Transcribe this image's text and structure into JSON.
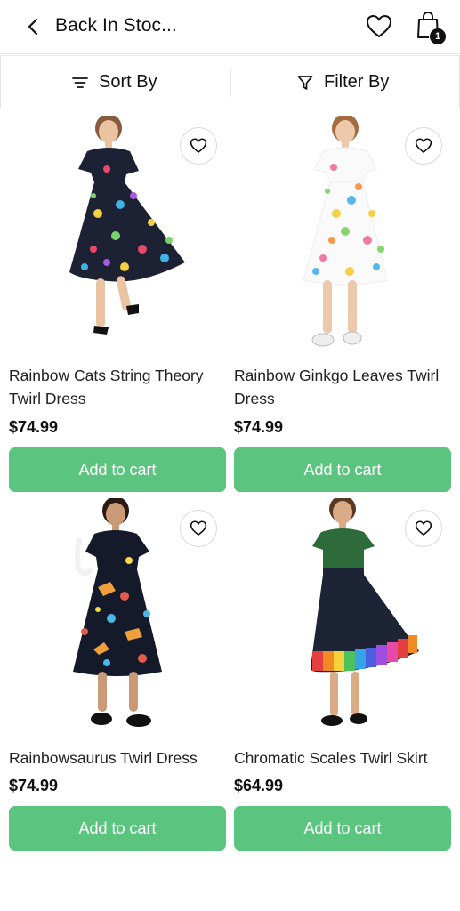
{
  "header": {
    "title": "Back In Stoc...",
    "cart_count": "1"
  },
  "toolbar": {
    "sort_label": "Sort By",
    "filter_label": "Filter By"
  },
  "products": [
    {
      "name": "Rainbow Cats String Theory Twirl Dress",
      "price": "$74.99",
      "button": "Add to cart"
    },
    {
      "name": "Rainbow Ginkgo Leaves Twirl Dress",
      "price": "$74.99",
      "button": "Add to cart"
    },
    {
      "name": "Rainbowsaurus Twirl Dress",
      "price": "$74.99",
      "button": "Add to cart"
    },
    {
      "name": "Chromatic Scales Twirl Skirt",
      "price": "$64.99",
      "button": "Add to cart"
    }
  ],
  "colors": {
    "accent": "#5bc47f",
    "text": "#111111",
    "border": "#e4e4e4"
  }
}
